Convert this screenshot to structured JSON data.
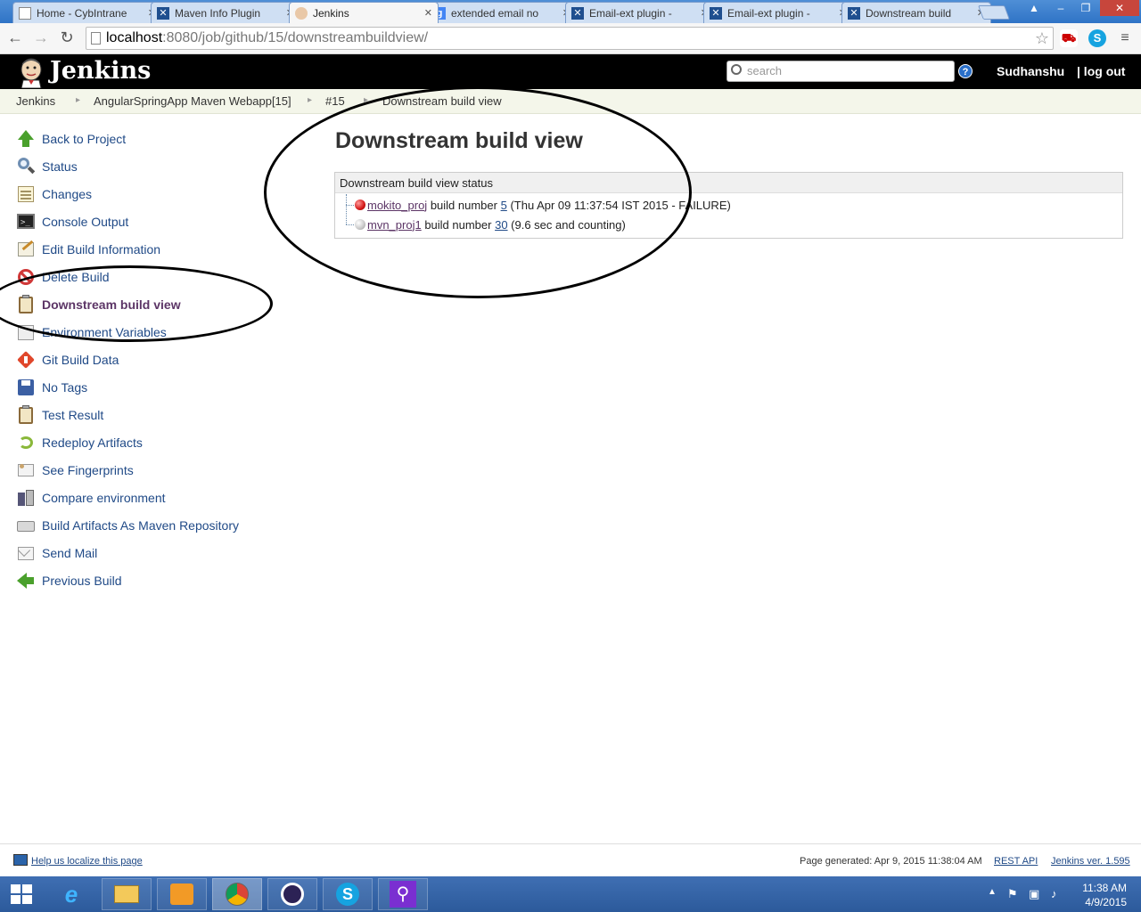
{
  "browser": {
    "tabs": [
      {
        "title": "Home - CybIntrane",
        "icon": "page-icon"
      },
      {
        "title": "Maven Info Plugin",
        "icon": "jira-icon"
      },
      {
        "title": "Jenkins",
        "icon": "jenkins-butler-icon",
        "active": true
      },
      {
        "title": "extended email no",
        "icon": "google-icon"
      },
      {
        "title": "Email-ext plugin -",
        "icon": "jira-icon"
      },
      {
        "title": "Email-ext plugin -",
        "icon": "jira-icon"
      },
      {
        "title": "Downstream build",
        "icon": "jira-icon"
      }
    ],
    "url_host": "localhost",
    "url_path": ":8080/job/github/15/downstreambuildview/"
  },
  "header": {
    "title": "Jenkins",
    "search_placeholder": "search",
    "help": "?",
    "user": "Sudhanshu",
    "logout": "| log out"
  },
  "breadcrumbs": [
    "Jenkins",
    "AngularSpringApp Maven Webapp[15]",
    "#15",
    "Downstream build view"
  ],
  "sidebar": {
    "items": [
      {
        "label": "Back to Project",
        "icon": "up-arrow-icon"
      },
      {
        "label": "Status",
        "icon": "magnifier-icon"
      },
      {
        "label": "Changes",
        "icon": "notepad-icon"
      },
      {
        "label": "Console Output",
        "icon": "terminal-icon"
      },
      {
        "label": "Edit Build Information",
        "icon": "edit-icon"
      },
      {
        "label": "Delete Build",
        "icon": "no-entry-icon"
      },
      {
        "label": "Downstream build view",
        "icon": "clipboard-icon",
        "active": true
      },
      {
        "label": "Environment Variables",
        "icon": "document-icon"
      },
      {
        "label": "Git Build Data",
        "icon": "git-icon"
      },
      {
        "label": "No Tags",
        "icon": "floppy-icon"
      },
      {
        "label": "Test Result",
        "icon": "clipboard-icon"
      },
      {
        "label": "Redeploy Artifacts",
        "icon": "redeploy-icon"
      },
      {
        "label": "See Fingerprints",
        "icon": "fingerprint-icon"
      },
      {
        "label": "Compare environment",
        "icon": "compare-icon"
      },
      {
        "label": "Build Artifacts As Maven Repository",
        "icon": "drive-icon"
      },
      {
        "label": "Send Mail",
        "icon": "mail-icon"
      },
      {
        "label": "Previous Build",
        "icon": "back-arrow-icon"
      }
    ]
  },
  "main": {
    "title": "Downstream build view",
    "panel_heading": "Downstream build view status",
    "builds": [
      {
        "project": "mokito_proj",
        "text1": " build number ",
        "number": "5",
        "text2": " (Thu Apr 09 11:37:54 IST 2015 - FAILURE)",
        "status_color": "#d41818"
      },
      {
        "project": "mvn_proj1",
        "text1": " build number ",
        "number": "30",
        "text2": " (9.6 sec and counting)",
        "status_color": "#c8c8c8"
      }
    ]
  },
  "footer": {
    "localize": "Help us localize this page",
    "generated": "Page generated: Apr 9, 2015 11:38:04 AM",
    "rest_api": "REST API",
    "version": "Jenkins ver. 1.595"
  },
  "taskbar": {
    "time": "11:38 AM",
    "date": "4/9/2015"
  }
}
